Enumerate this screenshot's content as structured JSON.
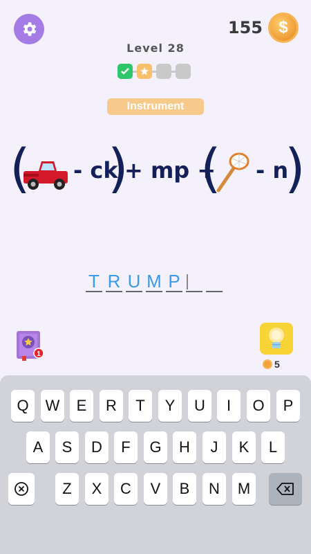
{
  "header": {
    "coins": "155",
    "coin_symbol": "$",
    "level": "Level 28"
  },
  "category": "Instrument",
  "puzzle": {
    "paren_left": "(",
    "paren_right": ")",
    "minus_ck": "- ck",
    "plus_mp": "+ mp +",
    "minus_n": "- n"
  },
  "answer": {
    "letters": [
      "T",
      "R",
      "U",
      "M",
      "P",
      "",
      ""
    ]
  },
  "hint": {
    "cost": "5"
  },
  "badge": {
    "count": "1"
  },
  "keyboard": {
    "row1": [
      "Q",
      "W",
      "E",
      "R",
      "T",
      "Y",
      "U",
      "I",
      "O",
      "P"
    ],
    "row2": [
      "A",
      "S",
      "D",
      "F",
      "G",
      "H",
      "J",
      "K",
      "L"
    ],
    "row3": [
      "Z",
      "X",
      "C",
      "V",
      "B",
      "N",
      "M"
    ]
  },
  "colors": {
    "accent": "#a57be6",
    "ink": "#14205a",
    "answer": "#3a9be8",
    "category_bg": "#f7c98b"
  }
}
